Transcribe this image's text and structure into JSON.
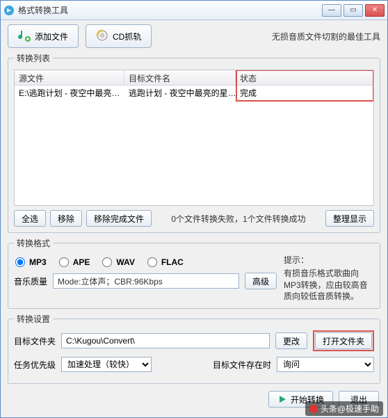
{
  "window": {
    "title": "格式转换工具"
  },
  "toolbar": {
    "add_file": "添加文件",
    "cd_rip": "CD抓轨"
  },
  "slogan": "无损音质文件切割的最佳工具",
  "list": {
    "legend": "转换列表",
    "headers": {
      "source": "源文件",
      "target": "目标文件名",
      "status": "状态"
    },
    "rows": [
      {
        "source": "E:\\逃跑计划 - 夜空中最亮…",
        "target": "逃跑计划 - 夜空中最亮的星…",
        "status": "完成"
      }
    ],
    "actions": {
      "select_all": "全选",
      "remove": "移除",
      "remove_done": "移除完成文件",
      "tidy": "整理显示"
    },
    "status_text": "0个文件转换失败，1个文件转换成功"
  },
  "format": {
    "legend": "转换格式",
    "options": {
      "mp3": "MP3",
      "ape": "APE",
      "wav": "WAV",
      "flac": "FLAC"
    },
    "selected": "mp3",
    "tip_title": "提示：",
    "tip_body": "有损音乐格式歌曲向MP3转换，应由较高音质向较低音质转换。",
    "quality_label": "音乐质量",
    "quality_value": "Mode:立体声；CBR:96Kbps",
    "advanced": "高级"
  },
  "settings": {
    "legend": "转换设置",
    "dest_label": "目标文件夹",
    "dest_value": "C:\\Kugou\\Convert\\",
    "change": "更改",
    "open_folder": "打开文件夹",
    "priority_label": "任务优先级",
    "priority_value": "加速处理（较快）",
    "exists_label": "目标文件存在时",
    "exists_value": "询问"
  },
  "bottom": {
    "start": "开始转换",
    "exit": "退出"
  },
  "footer": {
    "brand": "头条@极速手助"
  }
}
